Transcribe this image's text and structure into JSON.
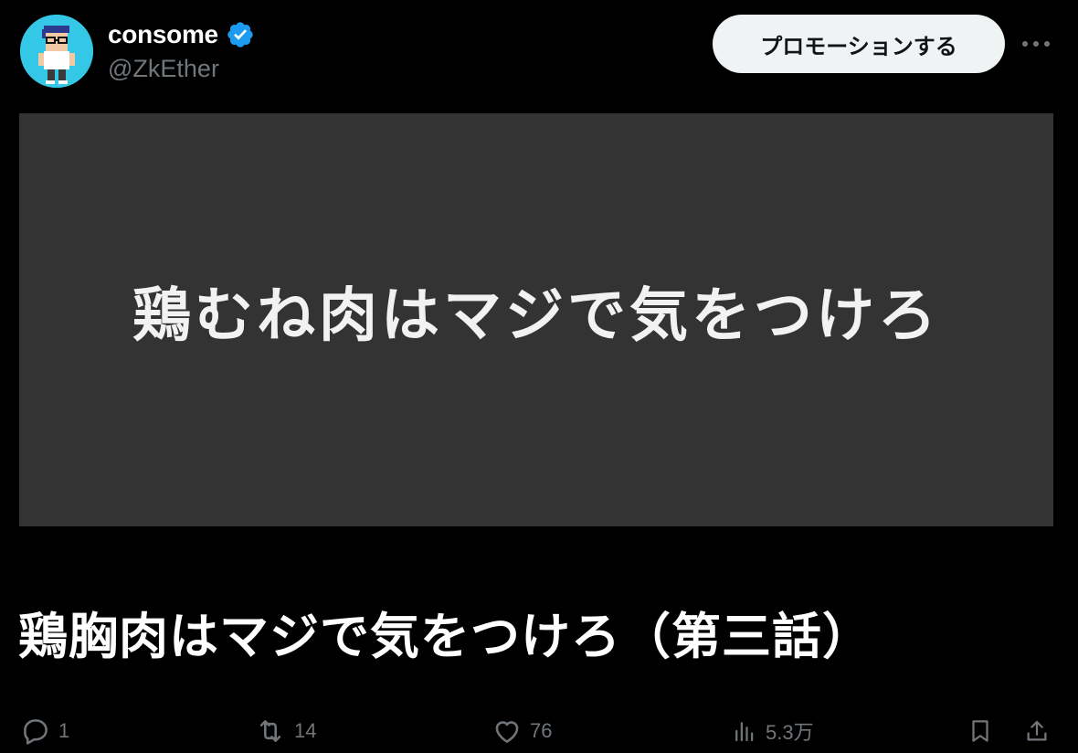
{
  "author": {
    "display_name": "consome",
    "handle": "@ZkEther",
    "verified": true,
    "avatar_icon": "pixel-art-avatar"
  },
  "header": {
    "promote_label": "プロモーションする",
    "more_icon": "more-dots-icon"
  },
  "media": {
    "caption": "鶏むね肉はマジで気をつけろ",
    "background_color": "#333333"
  },
  "tweet": {
    "text": "鶏胸肉はマジで気をつけろ（第三話）"
  },
  "actions": {
    "reply_count": "1",
    "repost_count": "14",
    "like_count": "76",
    "view_count": "5.3万"
  },
  "colors": {
    "background": "#000000",
    "verified_badge": "#1d9bf0",
    "muted_text": "#71767b",
    "primary_text": "#ffffff"
  }
}
